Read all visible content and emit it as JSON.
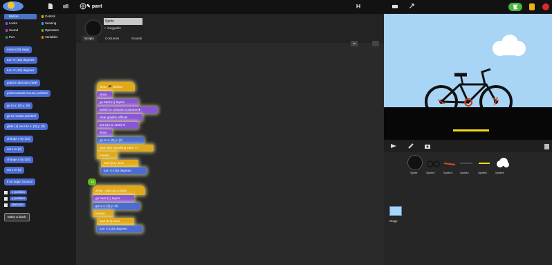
{
  "window": {
    "project_title": "pant"
  },
  "topbar": {
    "icons": [
      "scratch-logo",
      "file-icon",
      "folder-icon",
      "globe-icon",
      "turbo-icon"
    ],
    "controls": {
      "green_flag": "green-flag-icon",
      "pause": "pause-icon",
      "stop": "stop-icon"
    }
  },
  "palette": {
    "categories": [
      {
        "label": "Motion",
        "color": "#4a6cd4",
        "selected": true
      },
      {
        "label": "Control",
        "color": "#e1a91a"
      },
      {
        "label": "Looks",
        "color": "#8a55d7"
      },
      {
        "label": "Sensing",
        "color": "#2ca5e2"
      },
      {
        "label": "Sound",
        "color": "#bb42c3"
      },
      {
        "label": "Operators",
        "color": "#5cb712"
      },
      {
        "label": "Pen",
        "color": "#0e9a6c"
      },
      {
        "label": "Variables",
        "color": "#ee7d16"
      }
    ],
    "blocks": [
      "move (10) steps",
      "turn ↻ (15) degrees",
      "turn ↺ (15) degrees",
      "point in direction (90▾)",
      "point towards mouse-pointer▾",
      "go to x: (0) y: (0)",
      "go to mouse-pointer▾",
      "glide (1) secs to x: (0) y: (0)",
      "change x by (10)",
      "set x to (0)",
      "change y by (10)",
      "set y to (0)",
      "if on edge, bounce"
    ],
    "checks": [
      "x position",
      "y position",
      "direction"
    ],
    "make_block": "Make a block"
  },
  "sprite": {
    "name": "Sprite",
    "draggable_label": "✓ draggable",
    "tabs": [
      "Scripts",
      "Costumes",
      "Sounds"
    ],
    "active_tab": "Scripts"
  },
  "scripts": {
    "script1": [
      "when 🏴 clicked",
      "show",
      "go back (1) layers",
      "switch to costume costume1▾",
      "clear graphic effects",
      "set size to (100) %",
      "show",
      "go to x: (0) y: (0)",
      "wait until <touching color ?>",
      "forever",
      "wait (0.1) secs",
      "turn ↻ (15) degrees"
    ],
    "script2": [
      "when I start as a clone",
      "go back (1) layers",
      "go to x: (0) y: (0)",
      "forever",
      "wait (0.1) secs",
      "turn ↻ (15) degrees"
    ],
    "bubble": "10"
  },
  "stage": {
    "sky_color": "#a8d4f5",
    "ground_color": "#070707",
    "line_color": "#f5dd1a"
  },
  "library": {
    "toolbar_icons": [
      "paint-new-sprite-icon",
      "paintbrush-icon",
      "camera-icon",
      "trash-icon"
    ],
    "sprites": [
      "Sprite",
      "Sprite2",
      "Sprite3",
      "Sprite4",
      "Sprite5",
      "Sprite6"
    ],
    "stage_label": "Stage"
  }
}
